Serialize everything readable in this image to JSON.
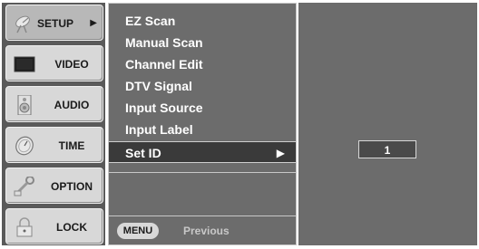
{
  "sidebar": {
    "items": [
      {
        "label": "SETUP",
        "icon": "satellite-dish-icon",
        "active": true,
        "arrow": "▶"
      },
      {
        "label": "VIDEO",
        "icon": "tv-screen-icon",
        "active": false
      },
      {
        "label": "AUDIO",
        "icon": "speaker-icon",
        "active": false
      },
      {
        "label": "TIME",
        "icon": "clock-icon",
        "active": false
      },
      {
        "label": "OPTION",
        "icon": "wrench-icon",
        "active": false
      },
      {
        "label": "LOCK",
        "icon": "padlock-icon",
        "active": false
      }
    ]
  },
  "menu": {
    "items": [
      {
        "label": "EZ Scan"
      },
      {
        "label": "Manual Scan"
      },
      {
        "label": "Channel Edit"
      },
      {
        "label": "DTV Signal"
      },
      {
        "label": "Input Source"
      },
      {
        "label": "Input Label"
      },
      {
        "label": "Set ID",
        "selected": true,
        "arrow": "▶"
      }
    ],
    "footer": {
      "button_label": "MENU",
      "hint": "Previous"
    }
  },
  "setid": {
    "value": "1"
  },
  "colors": {
    "sidebar_bg": "#5a5a5a",
    "panel_bg": "#6c6c6c",
    "selected_bg": "#3a3a3a",
    "button_bg": "#d8d8d8",
    "text_light": "#ffffff",
    "text_dark": "#1a1a1a"
  }
}
